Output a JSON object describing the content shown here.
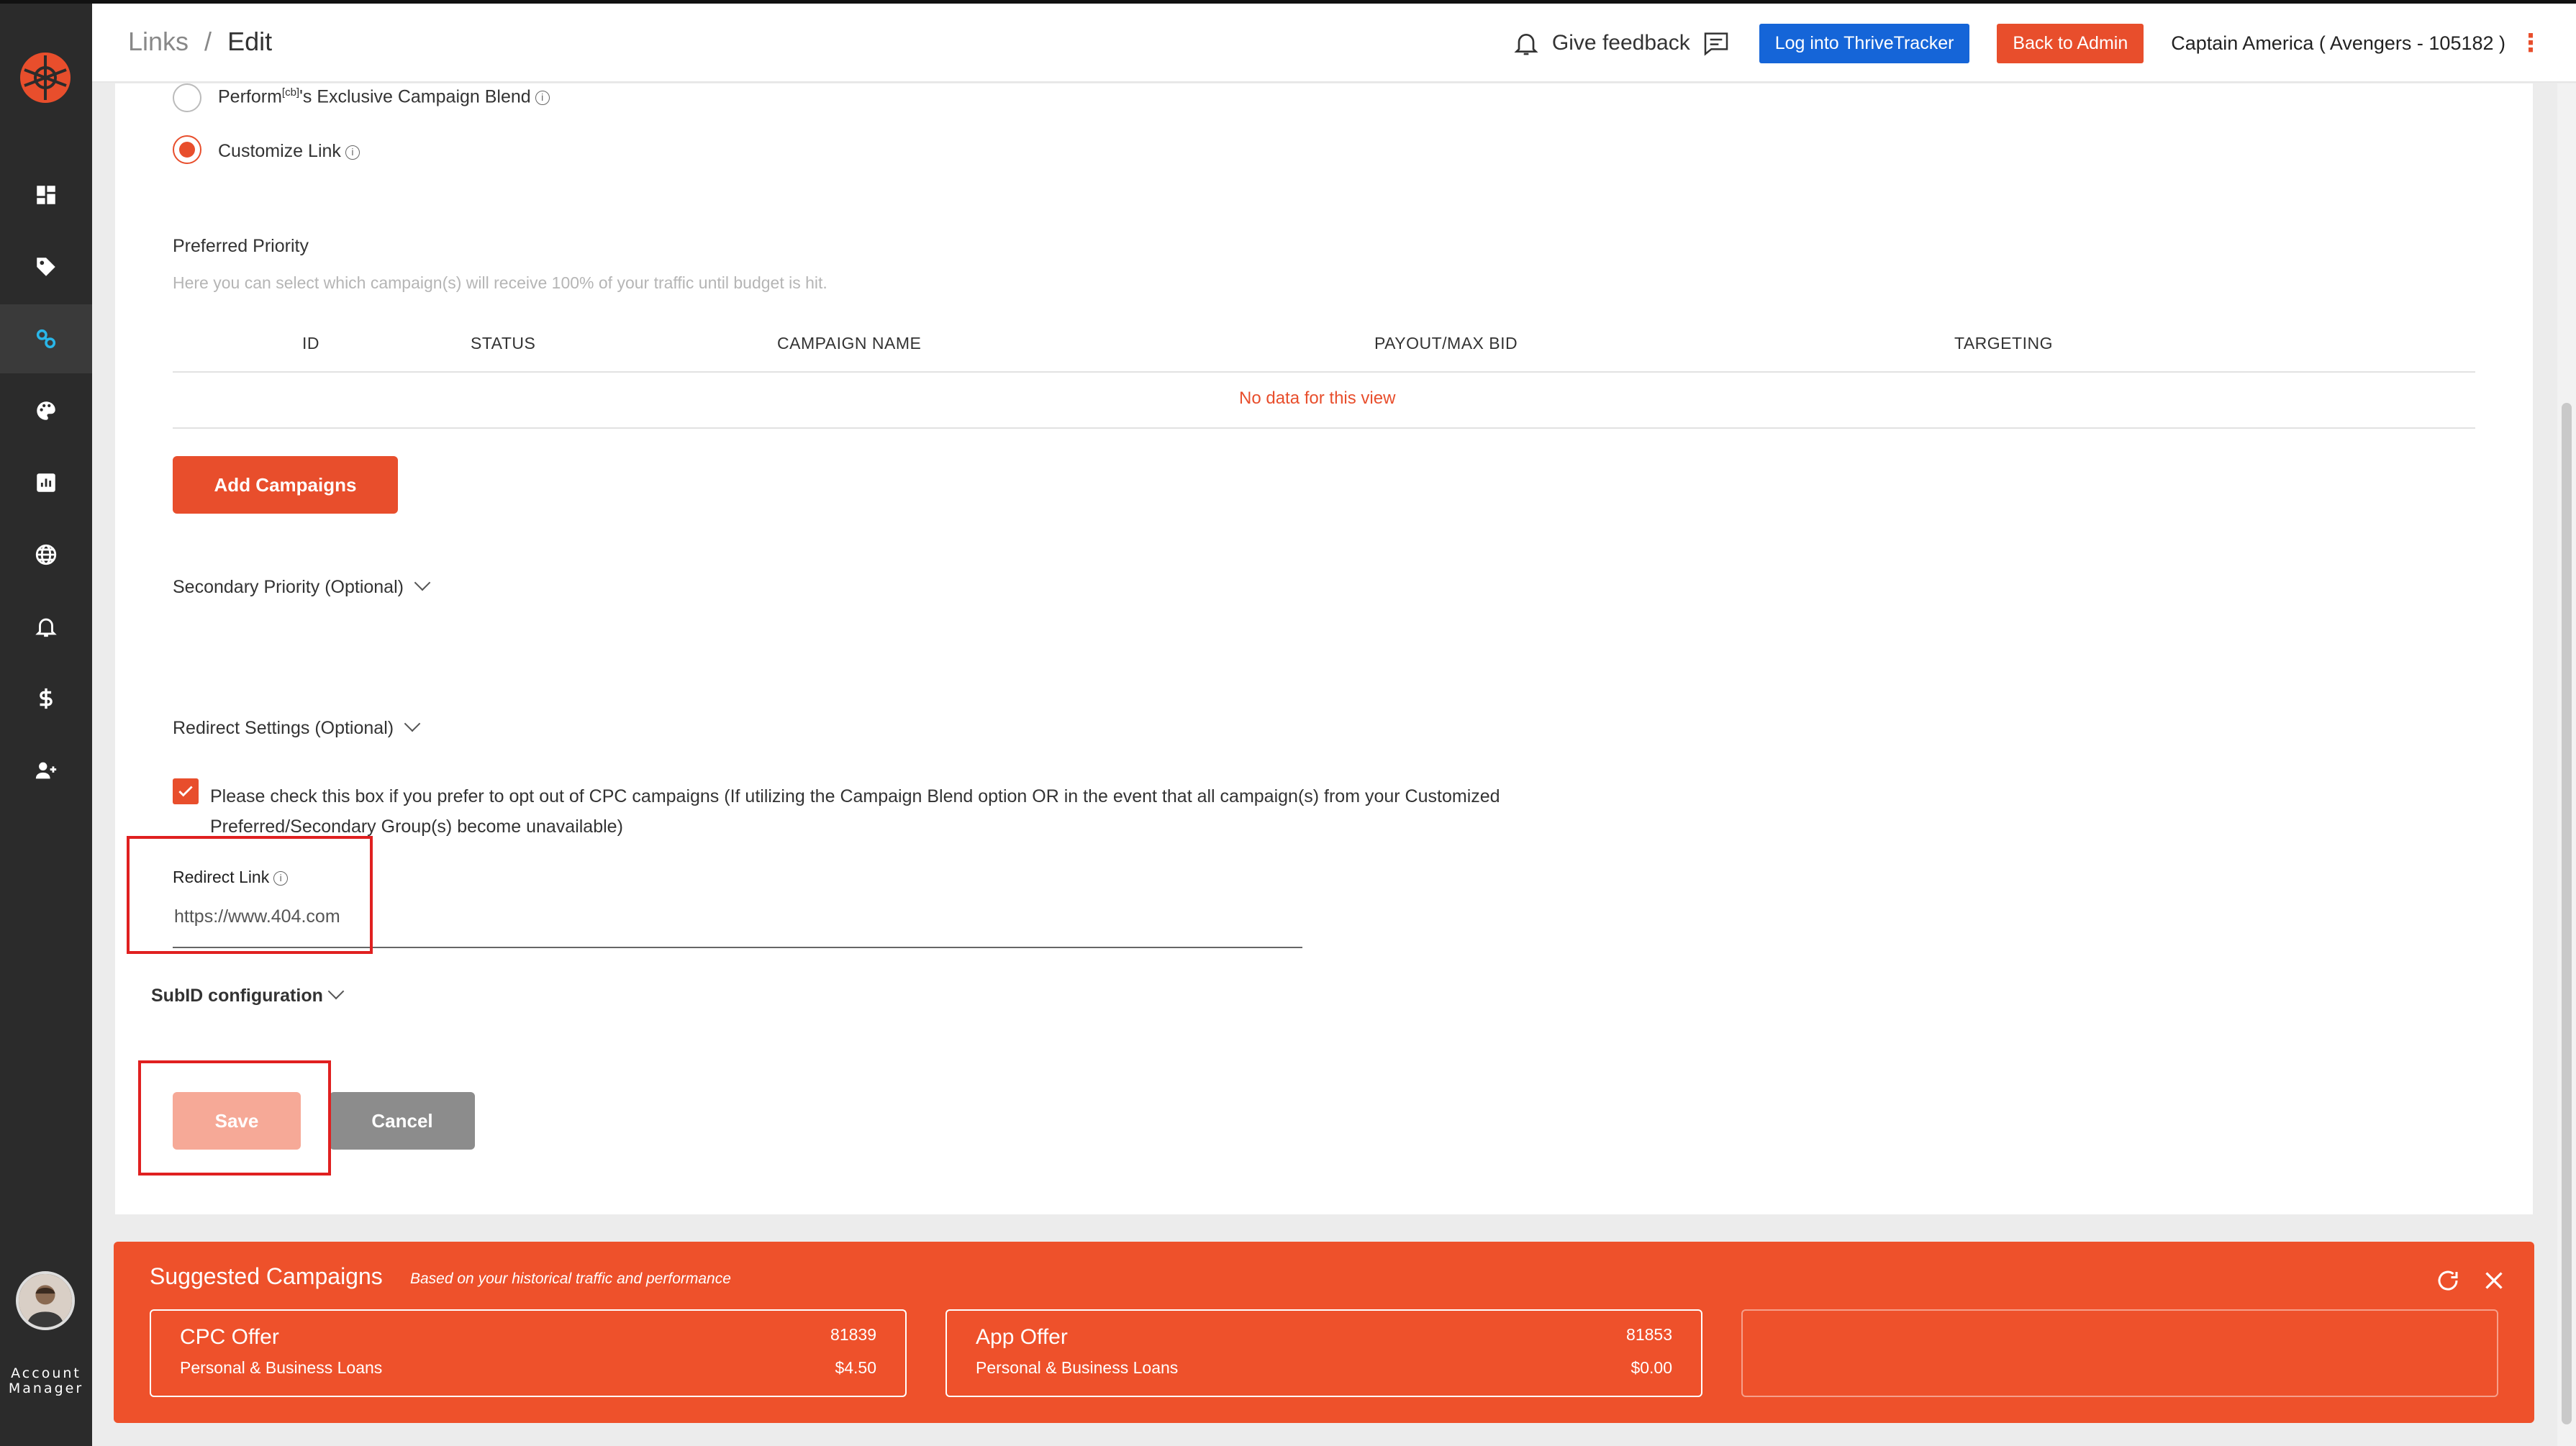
{
  "header": {
    "breadcrumb_root": "Links",
    "breadcrumb_sep": "/",
    "breadcrumb_current": "Edit",
    "feedback_label": "Give feedback",
    "thrive_button": "Log into ThriveTracker",
    "admin_button": "Back to Admin",
    "user_label": "Captain America ( Avengers - 105182 )"
  },
  "sidebar": {
    "items": [
      "dashboard-icon",
      "tag-icon",
      "link-icon",
      "palette-icon",
      "reports-icon",
      "globe-icon",
      "bell-icon",
      "dollar-icon",
      "add-user-icon"
    ],
    "active": "link-icon",
    "account_label_1": "Account",
    "account_label_2": "Manager"
  },
  "blend": {
    "option1_label": "Perform",
    "option1_sup": "[cb]",
    "option1_rest": "'s Exclusive Campaign Blend",
    "option2_label": "Customize Link",
    "selected": "Customize Link"
  },
  "preferred": {
    "title": "Preferred Priority",
    "help": "Here you can select which campaign(s) will receive 100% of your traffic until budget is hit.",
    "columns": [
      "ID",
      "STATUS",
      "CAMPAIGN NAME",
      "PAYOUT/MAX BID",
      "TARGETING"
    ],
    "empty_text": "No data for this view",
    "add_button": "Add Campaigns"
  },
  "secondary": {
    "title": "Secondary Priority (Optional)"
  },
  "redirect": {
    "title": "Redirect Settings (Optional)",
    "opt_out_checked": true,
    "opt_out_line1": "Please check this box if you prefer to opt out of CPC campaigns (If utilizing the Campaign Blend option OR in the event that all campaign(s) from your Customized",
    "opt_out_line2": "Preferred/Secondary Group(s) become unavailable)",
    "link_label": "Redirect Link",
    "link_value": "https://www.404.com"
  },
  "subid": {
    "title": "SubID configuration"
  },
  "actions": {
    "save": "Save",
    "cancel": "Cancel"
  },
  "suggested": {
    "title": "Suggested Campaigns",
    "subtitle": "Based on your historical traffic and performance",
    "cards": [
      {
        "name": "CPC Offer",
        "id": "81839",
        "category": "Personal & Business Loans",
        "payout": "$4.50"
      },
      {
        "name": "App Offer",
        "id": "81853",
        "category": "Personal & Business Loans",
        "payout": "$0.00"
      }
    ]
  },
  "colors": {
    "accent": "#e84e2c",
    "blue": "#1565d8",
    "sidebar": "#2b2b2b",
    "highlight": "#e02020"
  }
}
